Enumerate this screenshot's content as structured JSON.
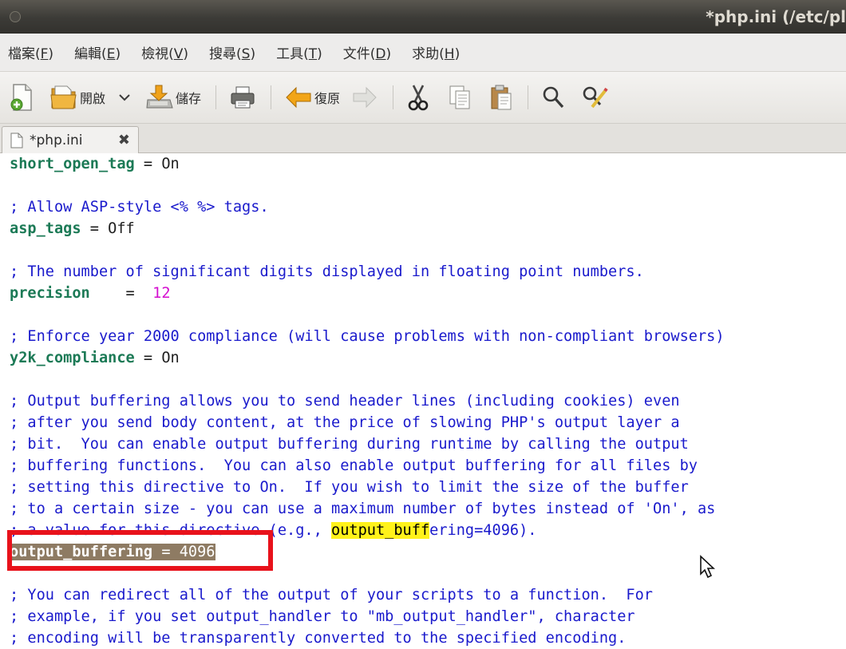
{
  "window": {
    "title": "*php.ini (/etc/pl"
  },
  "menu": {
    "items": [
      {
        "label": "檔案(",
        "key": "F",
        "end": ")"
      },
      {
        "label": "編輯(",
        "key": "E",
        "end": ")"
      },
      {
        "label": "檢視(",
        "key": "V",
        "end": ")"
      },
      {
        "label": "搜尋(",
        "key": "S",
        "end": ")"
      },
      {
        "label": "工具(",
        "key": "T",
        "end": ")"
      },
      {
        "label": "文件(",
        "key": "D",
        "end": ")"
      },
      {
        "label": "求助(",
        "key": "H",
        "end": ")"
      }
    ]
  },
  "toolbar": {
    "open_label": "開啟",
    "save_label": "儲存",
    "undo_label": "復原"
  },
  "tab": {
    "label": "*php.ini"
  },
  "editor": {
    "lines": [
      [
        {
          "t": "k",
          "s": "short_open_tag"
        },
        {
          "t": "v",
          "s": " = On"
        }
      ],
      [],
      [
        {
          "t": "c",
          "s": "; Allow ASP-style <% %> tags."
        }
      ],
      [
        {
          "t": "k",
          "s": "asp_tags"
        },
        {
          "t": "v",
          "s": " = Off"
        }
      ],
      [],
      [
        {
          "t": "c",
          "s": "; The number of significant digits displayed in floating point numbers."
        }
      ],
      [
        {
          "t": "k",
          "s": "precision"
        },
        {
          "t": "v",
          "s": "    =  "
        },
        {
          "t": "num",
          "s": "12"
        }
      ],
      [],
      [
        {
          "t": "c",
          "s": "; Enforce year 2000 compliance (will cause problems with non-compliant browsers)"
        }
      ],
      [
        {
          "t": "k",
          "s": "y2k_compliance"
        },
        {
          "t": "v",
          "s": " = On"
        }
      ],
      [],
      [
        {
          "t": "c",
          "s": "; Output buffering allows you to send header lines (including cookies) even"
        }
      ],
      [
        {
          "t": "c",
          "s": "; after you send body content, at the price of slowing PHP's output layer a"
        }
      ],
      [
        {
          "t": "c",
          "s": "; bit.  You can enable output buffering during runtime by calling the output"
        }
      ],
      [
        {
          "t": "c",
          "s": "; buffering functions.  You can also enable output buffering for all files by"
        }
      ],
      [
        {
          "t": "c",
          "s": "; setting this directive to On.  If you wish to limit the size of the buffer"
        }
      ],
      [
        {
          "t": "c",
          "s": "; to a certain size - you can use a maximum number of bytes instead of 'On', as"
        }
      ],
      [
        {
          "t": "c",
          "s": "; a value for this directive (e.g., "
        },
        {
          "t": "hl",
          "s": "output_buff"
        },
        {
          "t": "c",
          "s": "ering=4096)."
        }
      ],
      [
        {
          "t": "sel",
          "s": "output_buffering"
        },
        {
          "t": "selv",
          "s": " = 4096"
        }
      ],
      [],
      [
        {
          "t": "c",
          "s": "; You can redirect all of the output of your scripts to a function.  For"
        }
      ],
      [
        {
          "t": "c",
          "s": "; example, if you set output_handler to \"mb_output_handler\", character"
        }
      ],
      [
        {
          "t": "c",
          "s": "; encoding will be transparently converted to the specified encoding."
        }
      ]
    ]
  }
}
